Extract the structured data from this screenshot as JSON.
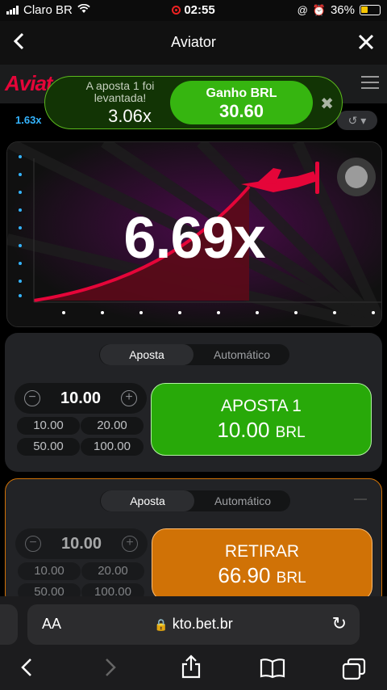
{
  "status": {
    "carrier": "Claro BR",
    "time": "02:55",
    "battery": "36%"
  },
  "webview": {
    "title": "Aviator"
  },
  "toast": {
    "label": "A aposta 1 foi levantada!",
    "multiplier": "3.06x",
    "win_title": "Ganho BRL",
    "win_amount": "30.60"
  },
  "history_multiplier": "1.63x",
  "game": {
    "multiplier": "6.69x"
  },
  "panel1": {
    "tab_bet": "Aposta",
    "tab_auto": "Automático",
    "stake": "10.00",
    "quick": [
      "10.00",
      "20.00",
      "50.00",
      "100.00"
    ],
    "button_title": "APOSTA 1",
    "button_amount": "10.00",
    "button_currency": "BRL"
  },
  "panel2": {
    "tab_bet": "Aposta",
    "tab_auto": "Automático",
    "stake": "10.00",
    "quick": [
      "10.00",
      "20.00",
      "50.00",
      "100.00"
    ],
    "button_title": "RETIRAR",
    "button_amount": "66.90",
    "button_currency": "BRL"
  },
  "safari": {
    "aa": "AA",
    "url": "kto.bet.br"
  },
  "colors": {
    "accent_red": "#e50539",
    "win_green": "#28a909",
    "cashout_orange": "#d07206"
  }
}
